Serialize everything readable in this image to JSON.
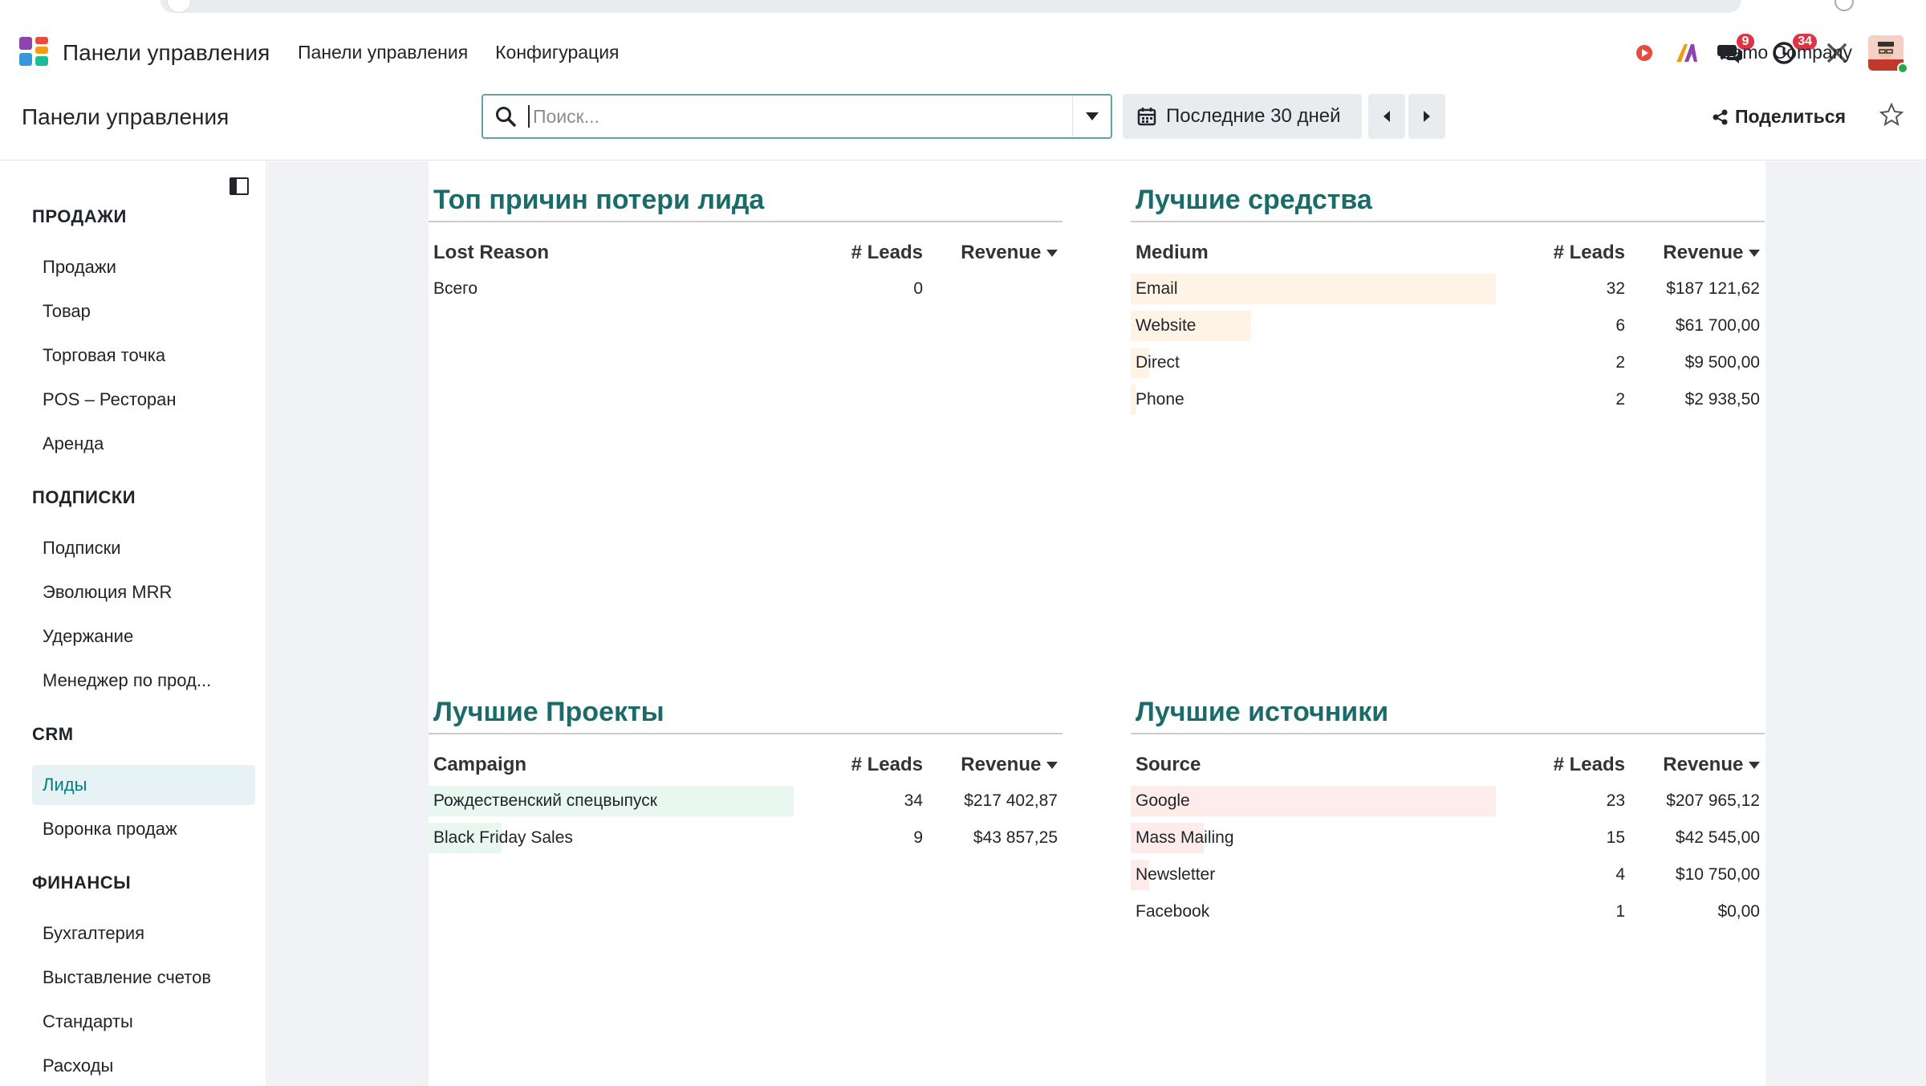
{
  "navbar": {
    "brand": "Панели управления",
    "menu": [
      "Панели управления",
      "Конфигурация"
    ],
    "messages_count": "9",
    "activities_count": "34",
    "company": "Demo Company"
  },
  "control": {
    "title": "Панели управления",
    "search_placeholder": "Поиск...",
    "date_filter": "Последние 30 дней",
    "share_label": "Поделиться"
  },
  "sidebar": {
    "sections": [
      {
        "title": "ПРОДАЖИ",
        "items": [
          "Продажи",
          "Товар",
          "Торговая точка",
          "POS – Ресторан",
          "Аренда"
        ]
      },
      {
        "title": "ПОДПИСКИ",
        "items": [
          "Подписки",
          "Эволюция MRR",
          "Удержание",
          "Менеджер по прод..."
        ]
      },
      {
        "title": "CRM",
        "items": [
          "Лиды",
          "Воронка продаж"
        ]
      },
      {
        "title": "ФИНАНСЫ",
        "items": [
          "Бухгалтерия",
          "Выставление счетов",
          "Стандарты",
          "Расходы"
        ]
      }
    ],
    "active_item": "Лиды"
  },
  "panels": {
    "lost": {
      "title": "Топ причин потери лида",
      "columns": [
        "Lost Reason",
        "# Leads",
        "Revenue"
      ],
      "rows": [
        {
          "name": "Всего",
          "leads": "0",
          "revenue": ""
        }
      ]
    },
    "medium": {
      "title": "Лучшие средства",
      "columns": [
        "Medium",
        "# Leads",
        "Revenue"
      ],
      "bar_color": "#fff3e6",
      "rows": [
        {
          "name": "Email",
          "leads": "32",
          "revenue": "$187 121,62",
          "share": 1.0
        },
        {
          "name": "Website",
          "leads": "6",
          "revenue": "$61 700,00",
          "share": 0.33
        },
        {
          "name": "Direct",
          "leads": "2",
          "revenue": "$9 500,00",
          "share": 0.05
        },
        {
          "name": "Phone",
          "leads": "2",
          "revenue": "$2 938,50",
          "share": 0.015
        }
      ]
    },
    "projects": {
      "title": "Лучшие Проекты",
      "columns": [
        "Campaign",
        "# Leads",
        "Revenue"
      ],
      "bar_color": "#e8f8f1",
      "rows": [
        {
          "name": "Рождественский спецвыпуск",
          "leads": "34",
          "revenue": "$217 402,87",
          "share": 1.0
        },
        {
          "name": "Black Friday Sales",
          "leads": "9",
          "revenue": "$43 857,25",
          "share": 0.2
        }
      ]
    },
    "sources": {
      "title": "Лучшие источники",
      "columns": [
        "Source",
        "# Leads",
        "Revenue"
      ],
      "bar_color": "#fdecea",
      "rows": [
        {
          "name": "Google",
          "leads": "23",
          "revenue": "$207 965,12",
          "share": 1.0
        },
        {
          "name": "Mass Mailing",
          "leads": "15",
          "revenue": "$42 545,00",
          "share": 0.2
        },
        {
          "name": "Newsletter",
          "leads": "4",
          "revenue": "$10 750,00",
          "share": 0.05
        },
        {
          "name": "Facebook",
          "leads": "1",
          "revenue": "$0,00",
          "share": 0
        }
      ]
    }
  }
}
